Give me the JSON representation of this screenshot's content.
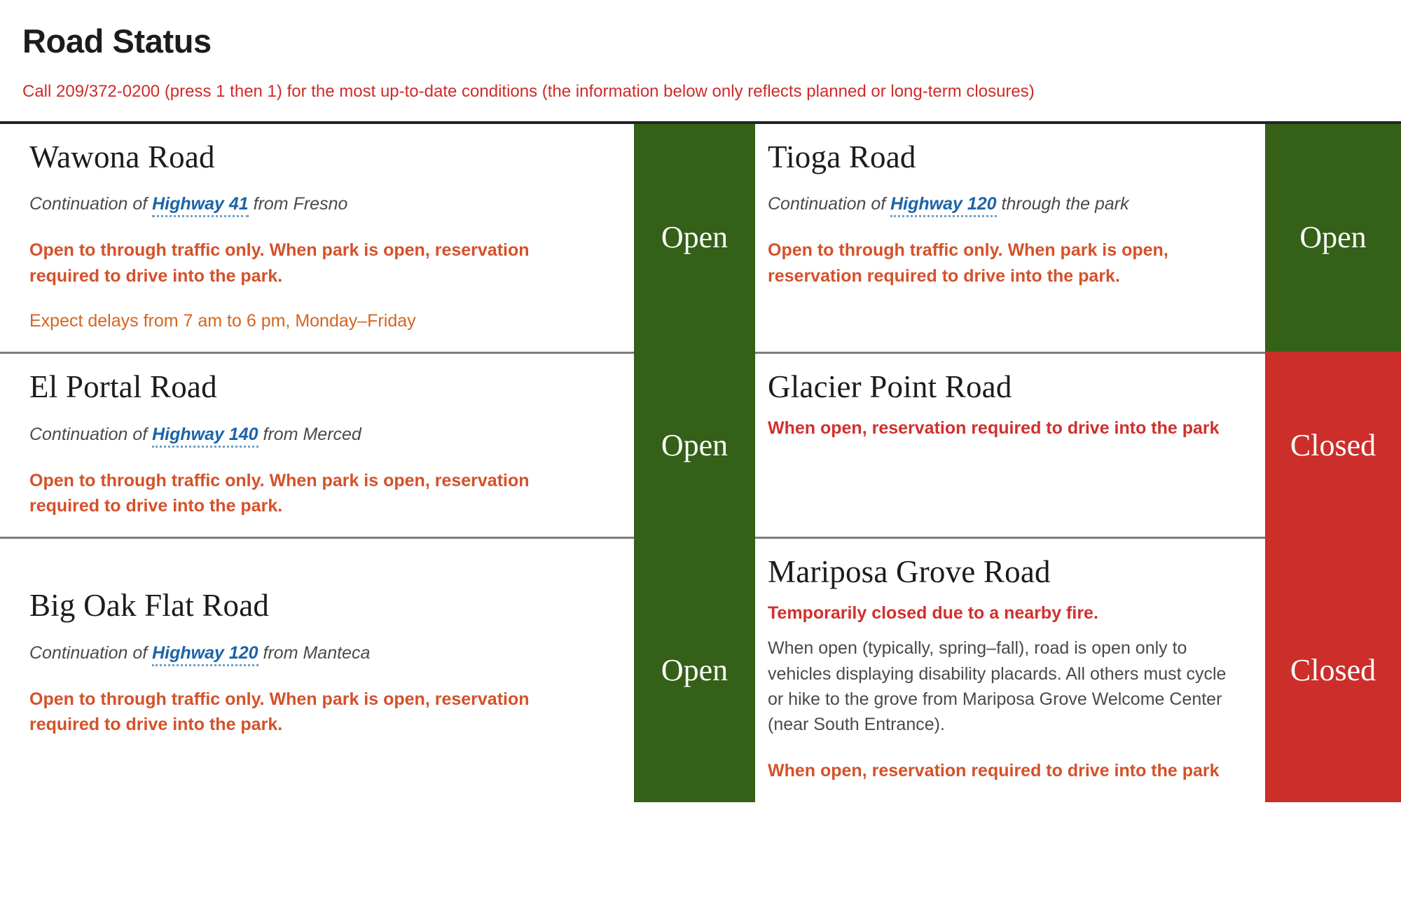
{
  "header": {
    "title": "Road Status",
    "hotline": "Call 209/372-0200 (press 1 then 1) for the most up-to-date conditions (the information below only reflects planned or long-term closures)"
  },
  "labels": {
    "continuation_prefix": "Continuation of "
  },
  "roads": {
    "wawona": {
      "name": "Wawona Road",
      "continuation_prefix": "Continuation of ",
      "highway": "Highway 41",
      "continuation_suffix": " from Fresno",
      "note1": "Open to through traffic only. When park is open, reservation required to drive into the park.",
      "note2": "Expect delays from 7 am to 6 pm, Monday–Friday",
      "status": "Open"
    },
    "tioga": {
      "name": "Tioga Road",
      "continuation_prefix": "Continuation of ",
      "highway": "Highway 120",
      "continuation_suffix": " through the park",
      "note1": "Open to through traffic only. When park is open, reservation required to drive into the park.",
      "status": "Open"
    },
    "el_portal": {
      "name": "El Portal Road",
      "continuation_prefix": "Continuation of ",
      "highway": "Highway 140",
      "continuation_suffix": " from Merced",
      "note1": "Open to through traffic only. When park is open, reservation required to drive into the park.",
      "status": "Open"
    },
    "glacier_point": {
      "name": "Glacier Point Road",
      "note1": "When open, reservation required to drive into the park",
      "status": "Closed"
    },
    "big_oak_flat": {
      "name": "Big Oak Flat Road",
      "continuation_prefix": "Continuation of ",
      "highway": "Highway 120",
      "continuation_suffix": " from Manteca",
      "note1": "Open to through traffic only. When park is open, reservation required to drive into the park.",
      "status": "Open"
    },
    "mariposa_grove": {
      "name": "Mariposa Grove Road",
      "note1": "Temporarily closed due to a nearby fire.",
      "note2": "When open (typically, spring–fall), road is open only to vehicles displaying disability placards. All others must cycle or hike to the grove from Mariposa Grove Welcome Center (near South Entrance).",
      "note3": "When open, reservation required to drive into the park",
      "status": "Closed"
    }
  },
  "colors": {
    "open_green": "#346018",
    "closed_red": "#cc2e2a",
    "alert_red": "#cf2b28",
    "note_orange": "#d4512a",
    "link_blue": "#1c63a8"
  }
}
